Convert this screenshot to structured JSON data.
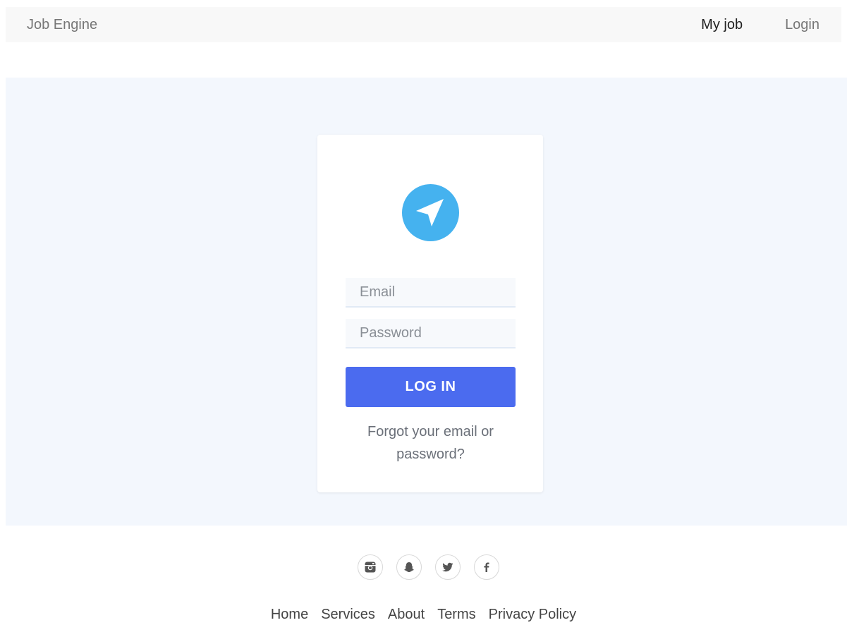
{
  "navbar": {
    "brand": "Job Engine",
    "links": [
      {
        "label": "My job",
        "active": true
      },
      {
        "label": "Login",
        "active": false
      }
    ]
  },
  "login_card": {
    "logo_icon": "navigation-arrow-icon",
    "logo_color": "#45b2ef",
    "email_placeholder": "Email",
    "email_value": "",
    "password_placeholder": "Password",
    "password_value": "",
    "login_label": "LOG IN",
    "login_color": "#4b6bef",
    "forgot_label": "Forgot your email or password?"
  },
  "social": [
    {
      "icon": "instagram-icon"
    },
    {
      "icon": "snapchat-icon"
    },
    {
      "icon": "twitter-icon"
    },
    {
      "icon": "facebook-icon"
    }
  ],
  "footer": {
    "links": [
      "Home",
      "Services",
      "About",
      "Terms",
      "Privacy Policy"
    ]
  }
}
